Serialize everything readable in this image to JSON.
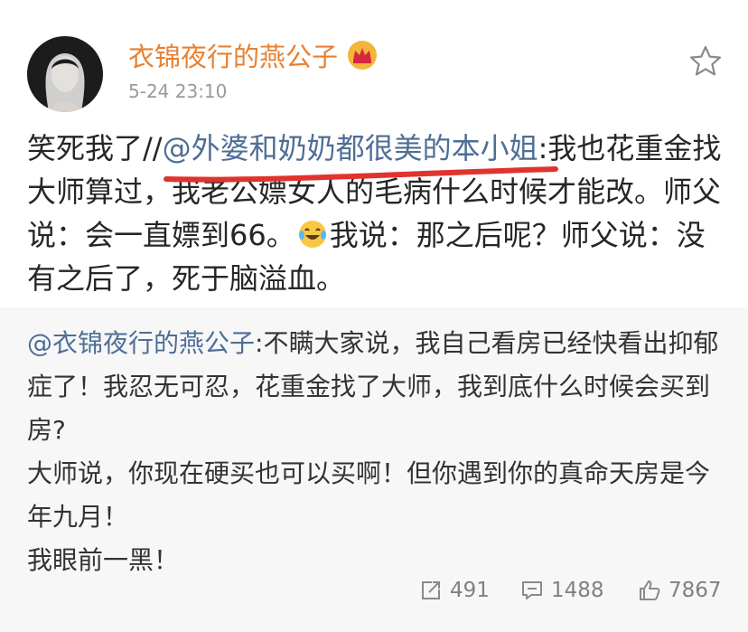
{
  "post": {
    "username": "衣锦夜行的燕公子",
    "timestamp": "5-24 23:10",
    "body_prefix": "笑死我了//",
    "body_mention": "@外婆和奶奶都很美的本小姐",
    "body_text_1": ":我也花重金找大师算过，我老公嫖女人的毛病什么时候才能改。师父说：会一直嫖到66。",
    "body_text_2": "我说：那之后呢？师父说：没有之后了，死于脑溢血。"
  },
  "repost": {
    "mention": "@衣锦夜行的燕公子",
    "text": ":不瞒大家说，我自己看房已经快看出抑郁症了！我忍无可忍，花重金找了大师，我到底什么时候会买到房?",
    "line2": "大师说，你现在硬买也可以买啊！但你遇到你的真命天房是今年九月！",
    "line3": "我眼前一黑！"
  },
  "actions": {
    "repost_count": "491",
    "comment_count": "1488",
    "like_count": "7867"
  },
  "icons": {
    "avatar": "avatar-portrait",
    "crown": "crown-icon",
    "star": "star-icon",
    "emoji": "laughing-tears-emoji",
    "repost": "repost-icon",
    "comment": "comment-icon",
    "like": "thumbs-up-icon"
  },
  "colors": {
    "username": "#e8802f",
    "mention": "#4e6e96",
    "annotation_line": "#e0332d",
    "repost_bg": "#f7f7f7"
  }
}
